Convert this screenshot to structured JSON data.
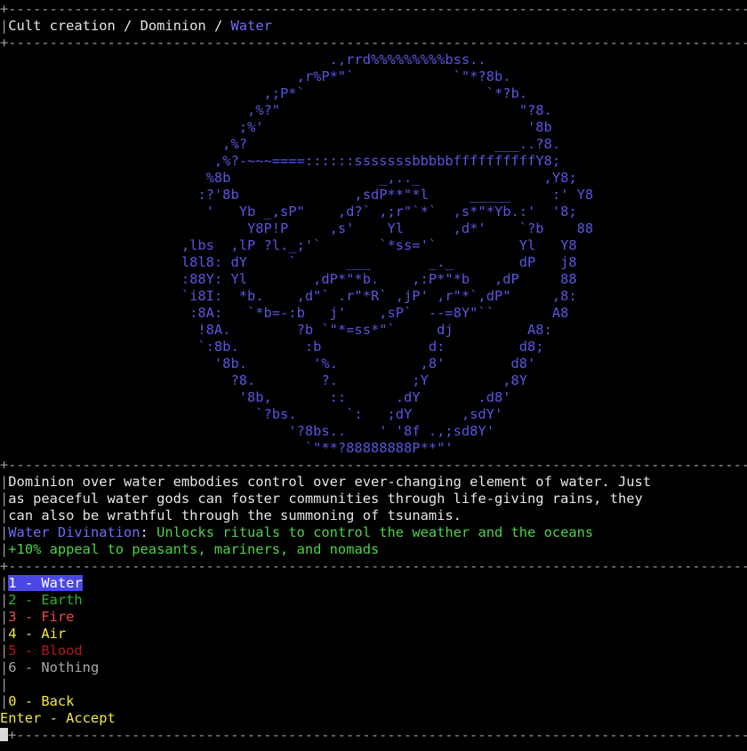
{
  "frame": {
    "top": "+----------------------------------------------------------------------------------------------+",
    "sep": "+----------------------------------------------------------------------------------------------+",
    "left": "|",
    "right": "|"
  },
  "breadcrumb": {
    "part1": "Cult creation",
    "sep1": " / ",
    "part2": "Dominion",
    "sep2": " / ",
    "current": "Water"
  },
  "art": [
    "                                        .,rrd%%%%%%%%%bss..",
    "                                    ,r%P*\"`            `\"*?8b.",
    "                                ,;P*`                      `*?b.",
    "                              ,%?\"                             \"?8.",
    "                             ;%'                                '8b",
    "                           ,%?                              ___..?8.",
    "                          ,%?-~~~====::::::sssssssbbbbbffffffffffY8;",
    "                         %8b                  _,.._               ,Y8;",
    "                        :?'8b              ,sdP**\"*l     _____     :' Y8",
    "                         '   Yb _,sP\"    ,d?` ,;r\"`*`  ,s*\"*Yb.:'  '8;",
    "                              Y8P!P     ,s'    Yl      ,d*'    `?b    88",
    "                      ,lbs  ,lP ?l._;'`       `*ss='`          Yl   Y8",
    "                      l8l8: dY     `      ___       _._        dP   j8",
    "                      :88Y: Yl        ,dP*\"*b.    ,:P*\"*b   ,dP     88",
    "                      `i8I:  *b.    ,d\"` .r\"*R` ,jP' ,r\"*`,dP\"     ,8:",
    "                       :8A:   `*b=-:b   j'    ,sP`  --=8Y\"``       A8",
    "                        !8A.        ?b `\"*=ss*\"`     dj         A8:",
    "                        `:8b.        :b             d:         d8;",
    "                          '8b.        '%.          ,8'        d8'",
    "                            ?8.        ?.         ;Y         ,8Y",
    "                             '8b,       ::      .dY       .d8'",
    "                               `?bs.      `:   ;dY      ,sdY'",
    "                                   '?8bs..    ' '8f .,;sd8Y'",
    "                                     `\"**?88888888P**\"'"
  ],
  "description": {
    "line1": "Dominion over water embodies control over ever-changing element of water. Just",
    "line2": "as peaceful water gods can foster communities through life-giving rains, they",
    "line3": "can also be wrathful through the summoning of tsunamis.",
    "ability_name": "Water Divination",
    "ability_sep": ": ",
    "ability_text": "Unlocks rituals to control the weather and the oceans",
    "bonus": "+10% appeal to peasants, mariners, and nomads"
  },
  "menu": {
    "options": [
      {
        "label": "1 - Water"
      },
      {
        "label": "2 - Earth"
      },
      {
        "label": "3 - Fire"
      },
      {
        "label": "4 - Air"
      },
      {
        "label": "5 - Blood"
      },
      {
        "label": "6 - Nothing"
      }
    ],
    "back": "0 - Back",
    "accept": "Enter - Accept"
  },
  "colors": {
    "background": "#000000",
    "art": "#5a55e0",
    "highlight_blue": "#6f6df5",
    "ability_green": "#4fd14a",
    "selection_bg": "#4b47e6",
    "earth": "#2fb52c",
    "fire": "#ef4a4a",
    "air": "#f2ea3e",
    "blood": "#b3161c",
    "nothing": "#a8a8a8"
  }
}
